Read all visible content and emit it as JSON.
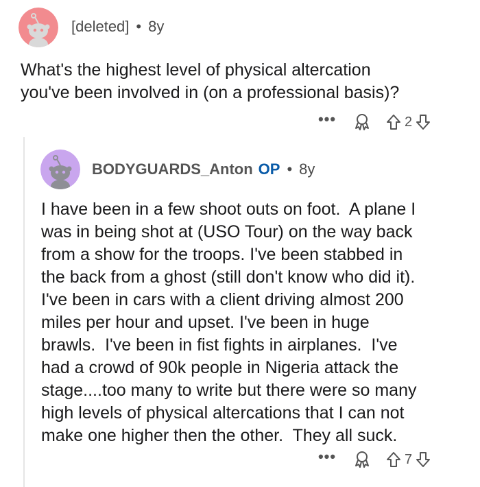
{
  "parent_comment": {
    "author": "[deleted]",
    "separator": "•",
    "age": "8y",
    "body": "What's the highest level of physical altercation\nyou've been involved in (on a professional basis)?",
    "more_label": "•••",
    "vote_count": "2",
    "avatar_color": "#f28b8f"
  },
  "reply_comment": {
    "author": "BODYGUARDS_Anton",
    "op_badge": "OP",
    "separator": "•",
    "age": "8y",
    "body": "I have been in a few shoot outs on foot.  A plane I\nwas in being shot at (USO Tour) on the way back\nfrom a show for the troops. I've been stabbed in\nthe back from a ghost (still don't know who did it).\nI've been in cars with a client driving almost 200\nmiles per hour and upset. I've been in huge\nbrawls.  I've been in fist fights in airplanes.  I've\nhad a crowd of 90k people in Nigeria attack the\nstage....too many to write but there were so many\nhigh levels of physical altercations that I can not\nmake one higher then the other.  They all suck.",
    "more_label": "•••",
    "vote_count": "7",
    "avatar_color": "#c9a6ee"
  },
  "colors": {
    "op_blue": "#0a5ba8",
    "meta_gray": "#4a4a4a",
    "text": "#1a1a1b"
  }
}
